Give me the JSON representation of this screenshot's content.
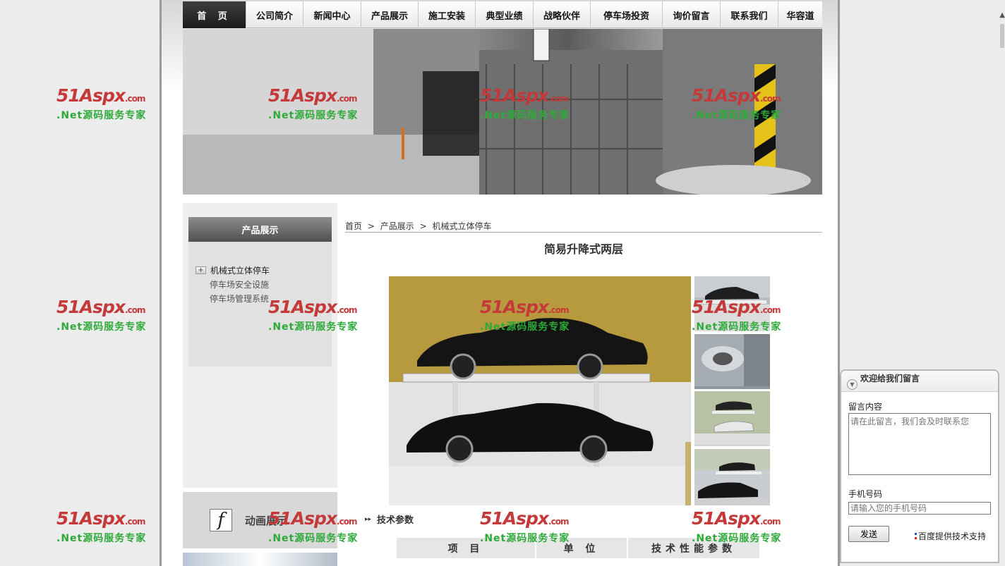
{
  "nav": {
    "items": [
      "首 页",
      "公司简介",
      "新闻中心",
      "产品展示",
      "施工安装",
      "典型业绩",
      "战略伙伴",
      "停车场投资",
      "询价留言",
      "联系我们",
      "华容道"
    ]
  },
  "sidebar": {
    "title": "产品展示",
    "items": [
      {
        "label": "机械式立体停车",
        "expand": "+"
      },
      {
        "label": "停车场安全设施"
      },
      {
        "label": "停车场管理系统"
      }
    ]
  },
  "flash": {
    "icon": "f",
    "label": "动画展示"
  },
  "breadcrumb": {
    "home": "首页",
    "sep": ">",
    "category": "产品展示",
    "current": "机械式立体停车"
  },
  "product": {
    "title": "简易升降式两层",
    "params_heading": "技术参数",
    "table_headers": [
      "项 目",
      "单 位",
      "技术性能参数"
    ]
  },
  "message": {
    "title": "欢迎给我们留言",
    "content_label": "留言内容",
    "content_placeholder": "请在此留言，我们会及时联系您",
    "phone_label": "手机号码",
    "phone_placeholder": "请输入您的手机号码",
    "send_label": "发送",
    "support": "百度提供技术支持"
  },
  "watermark": {
    "logo": "51Aspx",
    "com": ".com",
    "slogan": ".Net源码服务专家"
  }
}
